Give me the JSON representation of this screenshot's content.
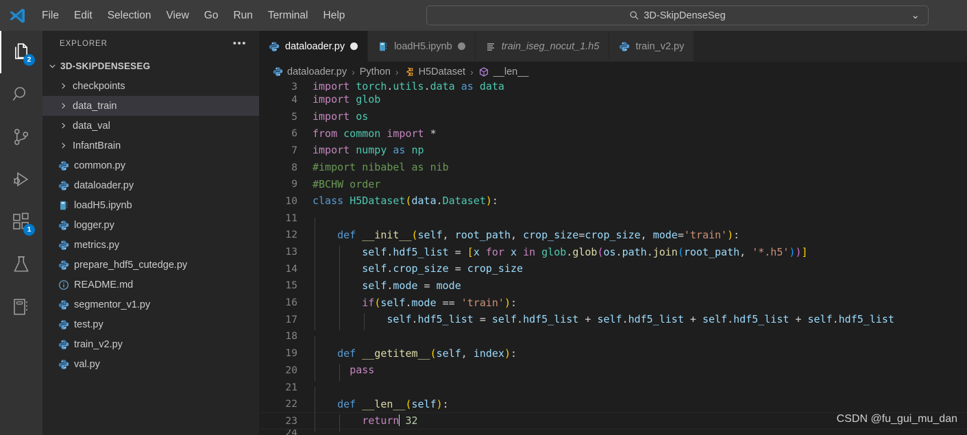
{
  "titlebar": {
    "logo_icon": "vscode-logo-icon",
    "menu": [
      {
        "label": "File"
      },
      {
        "label": "Edit"
      },
      {
        "label": "Selection"
      },
      {
        "label": "View"
      },
      {
        "label": "Go"
      },
      {
        "label": "Run"
      },
      {
        "label": "Terminal"
      },
      {
        "label": "Help"
      }
    ],
    "nav": {
      "back_icon": "arrow-left-icon",
      "forward_icon": "arrow-right-icon"
    },
    "quickopen": {
      "search_icon": "search-icon",
      "value": "3D-SkipDenseSeg",
      "chevron_icon": "chevron-down-icon"
    }
  },
  "activitybar": {
    "items": [
      {
        "name": "explorer",
        "icon": "files-icon",
        "badge": "2",
        "active": true
      },
      {
        "name": "search",
        "icon": "search-icon",
        "badge": "",
        "active": false
      },
      {
        "name": "source-control",
        "icon": "source-control-icon",
        "badge": "",
        "active": false
      },
      {
        "name": "run-and-debug",
        "icon": "run-debug-icon",
        "badge": "",
        "active": false
      },
      {
        "name": "extensions",
        "icon": "extensions-icon",
        "badge": "1",
        "active": false
      },
      {
        "name": "testing",
        "icon": "beaker-icon",
        "badge": "",
        "active": false
      },
      {
        "name": "notebook",
        "icon": "notebook-icon",
        "badge": "",
        "active": false
      }
    ]
  },
  "sidebar": {
    "title": "EXPLORER",
    "more_icon": "ellipsis-icon",
    "root": {
      "label": "3D-SKIPDENSESEG",
      "chevron_icon": "chevron-down-icon"
    },
    "items": [
      {
        "label": "checkpoints",
        "kind": "folder",
        "icon": "chevron-right-icon",
        "selected": false
      },
      {
        "label": "data_train",
        "kind": "folder",
        "icon": "chevron-right-icon",
        "selected": true
      },
      {
        "label": "data_val",
        "kind": "folder",
        "icon": "chevron-right-icon",
        "selected": false
      },
      {
        "label": "InfantBrain",
        "kind": "folder",
        "icon": "chevron-right-icon",
        "selected": false
      },
      {
        "label": "common.py",
        "kind": "file",
        "icon": "python-icon",
        "selected": false
      },
      {
        "label": "dataloader.py",
        "kind": "file",
        "icon": "python-icon",
        "selected": false
      },
      {
        "label": "loadH5.ipynb",
        "kind": "file",
        "icon": "notebook-icon",
        "selected": false
      },
      {
        "label": "logger.py",
        "kind": "file",
        "icon": "python-icon",
        "selected": false
      },
      {
        "label": "metrics.py",
        "kind": "file",
        "icon": "python-icon",
        "selected": false
      },
      {
        "label": "prepare_hdf5_cutedge.py",
        "kind": "file",
        "icon": "python-icon",
        "selected": false
      },
      {
        "label": "README.md",
        "kind": "file",
        "icon": "markdown-info-icon",
        "selected": false
      },
      {
        "label": "segmentor_v1.py",
        "kind": "file",
        "icon": "python-icon",
        "selected": false
      },
      {
        "label": "test.py",
        "kind": "file",
        "icon": "python-icon",
        "selected": false
      },
      {
        "label": "train_v2.py",
        "kind": "file",
        "icon": "python-icon",
        "selected": false
      },
      {
        "label": "val.py",
        "kind": "file",
        "icon": "python-icon",
        "selected": false
      }
    ]
  },
  "editor": {
    "tabs": [
      {
        "label": "dataloader.py",
        "icon": "python-icon",
        "active": true,
        "dirty": true,
        "dirty_state": "modified",
        "italic": false
      },
      {
        "label": "loadH5.ipynb",
        "icon": "notebook-icon",
        "active": false,
        "dirty": true,
        "dirty_state": "dim",
        "italic": false
      },
      {
        "label": "train_iseg_nocut_1.h5",
        "icon": "binary-lines-icon",
        "active": false,
        "dirty": false,
        "dirty_state": "",
        "italic": true
      },
      {
        "label": "train_v2.py",
        "icon": "python-icon",
        "active": false,
        "dirty": false,
        "dirty_state": "",
        "italic": false
      }
    ],
    "breadcrumb": [
      {
        "label": "dataloader.py",
        "icon": "python-icon"
      },
      {
        "label": "Python",
        "icon": ""
      },
      {
        "label": "H5Dataset",
        "icon": "class-icon"
      },
      {
        "label": "__len__",
        "icon": "method-icon"
      }
    ],
    "breadcrumb_separator": "›",
    "watermark": "CSDN @fu_gui_mu_dan",
    "lines": [
      {
        "num": "3",
        "text": "import torch.utils.data as data",
        "clipped_top": true
      },
      {
        "num": "4",
        "text": "import glob"
      },
      {
        "num": "5",
        "text": "import os"
      },
      {
        "num": "6",
        "text": "from common import *"
      },
      {
        "num": "7",
        "text": "import numpy as np"
      },
      {
        "num": "8",
        "text": "#import nibabel as nib"
      },
      {
        "num": "9",
        "text": "#BCHW order"
      },
      {
        "num": "10",
        "text": "class H5Dataset(data.Dataset):"
      },
      {
        "num": "11",
        "text": ""
      },
      {
        "num": "12",
        "text": "    def __init__(self, root_path, crop_size=crop_size, mode='train'):"
      },
      {
        "num": "13",
        "text": "        self.hdf5_list = [x for x in glob.glob(os.path.join(root_path, '*.h5'))]"
      },
      {
        "num": "14",
        "text": "        self.crop_size = crop_size"
      },
      {
        "num": "15",
        "text": "        self.mode = mode"
      },
      {
        "num": "16",
        "text": "        if(self.mode == 'train'):"
      },
      {
        "num": "17",
        "text": "            self.hdf5_list = self.hdf5_list + self.hdf5_list + self.hdf5_list + self.hdf5_list"
      },
      {
        "num": "18",
        "text": ""
      },
      {
        "num": "19",
        "text": "    def __getitem__(self, index):"
      },
      {
        "num": "20",
        "text": "      pass"
      },
      {
        "num": "21",
        "text": ""
      },
      {
        "num": "22",
        "text": "    def __len__(self):"
      },
      {
        "num": "23",
        "text": "        return 32",
        "current": true
      },
      {
        "num": "24",
        "text": "",
        "clipped_bottom": true
      }
    ]
  },
  "colors": {
    "accent": "#007acc",
    "titlebar_bg": "#3c3c3c",
    "activitybar_bg": "#333333",
    "sidebar_bg": "#252526",
    "editor_bg": "#1e1e1e",
    "selection_bg": "#37373d",
    "python_blue": "#3c78aa",
    "class_orange": "#ee9d28",
    "method_purple": "#b180d7"
  }
}
